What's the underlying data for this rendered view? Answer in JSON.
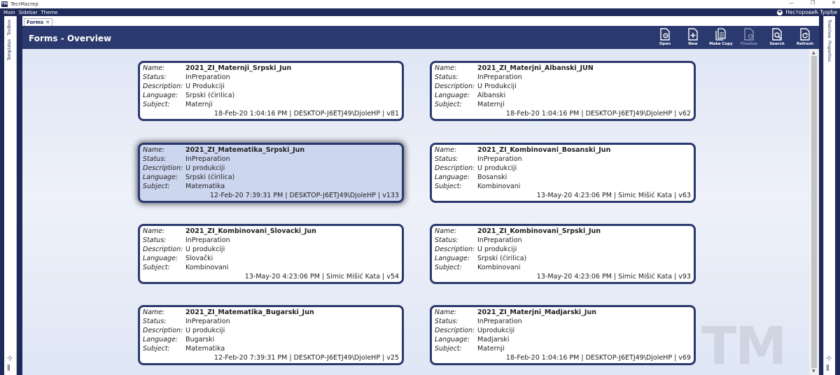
{
  "app": {
    "logo": "TM",
    "title": "TecrMacrep"
  },
  "window_controls": [
    "—",
    "❐",
    "✕"
  ],
  "menu": [
    "Main",
    "Sidebar",
    "Theme"
  ],
  "user": {
    "name": "Несторовић Ђорђе"
  },
  "left_tabs": [
    "Toolbox",
    "Templates"
  ],
  "right_tabs": [
    "TreeView",
    "Properties"
  ],
  "doc_tab": {
    "label": "Forms",
    "close": "✕"
  },
  "page_title": "Forms - Overview",
  "toolbar": [
    {
      "label": "Open",
      "icon": "open-icon",
      "enabled": true
    },
    {
      "label": "New",
      "icon": "new-icon",
      "enabled": true
    },
    {
      "label": "Make Copy",
      "icon": "copy-icon",
      "enabled": true
    },
    {
      "label": "Finalize",
      "icon": "finalize-icon",
      "enabled": false
    },
    {
      "label": "Search",
      "icon": "search-icon",
      "enabled": true
    },
    {
      "label": "Refresh",
      "icon": "refresh-icon",
      "enabled": true
    }
  ],
  "field_labels": {
    "name": "Name:",
    "status": "Status:",
    "description": "Description:",
    "language": "Language:",
    "subject": "Subject:"
  },
  "cards": [
    {
      "name": "2021_ZI_Maternji_Srpski_Jun",
      "status": "InPreparation",
      "description": "U Produkciji",
      "language": "Srpski (ćirilica)",
      "subject": "Maternji",
      "footer": "18-Feb-20 1:04:16 PM | DESKTOP-J6ETJ49\\DjoleHP | v81",
      "selected": false
    },
    {
      "name": "2021_ZI_Materjni_Albanski_JUN",
      "status": "InPreparation",
      "description": "U Produkciji",
      "language": "Albanski",
      "subject": "Maternji",
      "footer": "18-Feb-20 1:04:16 PM | DESKTOP-J6ETJ49\\DjoleHP | v62",
      "selected": false
    },
    {
      "name": "2021_ZI_Matematika_Srpski_Jun",
      "status": "InPreparation",
      "description": "U produkciji",
      "language": "Srpski (ćirilica)",
      "subject": "Matematika",
      "footer": "12-Feb-20 7:39:31 PM | DESKTOP-J6ETJ49\\DjoleHP | v133",
      "selected": true
    },
    {
      "name": "2021_ZI_Kombinovani_Bosanski_Jun",
      "status": "InPreparation",
      "description": "U produkciji",
      "language": "Bosanski",
      "subject": "Kombinovani",
      "footer": "13-May-20 4:23:06 PM | Simic Mišić Kata | v63",
      "selected": false
    },
    {
      "name": "2021_ZI_Kombinovani_Slovacki_Jun",
      "status": "InPreparation",
      "description": "U produkciji",
      "language": "Slovački",
      "subject": "Kombinovani",
      "footer": "13-May-20 4:23:06 PM | Simic Mišić Kata | v54",
      "selected": false
    },
    {
      "name": "2021_ZI_Kombinovani_Srpski_Jun",
      "status": "InPreparation",
      "description": "U produkciji",
      "language": "Srpski (ćirilica)",
      "subject": "Kombinovani",
      "footer": "13-May-20 4:23:06 PM | Simic Mišić Kata | v93",
      "selected": false
    },
    {
      "name": "2021_ZI_Matematika_Bugarski_Jun",
      "status": "InPreparation",
      "description": "U produkciji",
      "language": "Bugarski",
      "subject": "Matematika",
      "footer": "12-Feb-20 7:39:31 PM | DESKTOP-J6ETJ49\\DjoleHP | v25",
      "selected": false
    },
    {
      "name": "2021_ZI_Materjni_Madjarski_Jun",
      "status": "InPreparation",
      "description": "Uprodukciji",
      "language": "Madjarski",
      "subject": "Maternji",
      "footer": "18-Feb-20 1:04:16 PM | DESKTOP-J6ETJ49\\DjoleHP | v69",
      "selected": false
    }
  ],
  "watermark": "TM"
}
